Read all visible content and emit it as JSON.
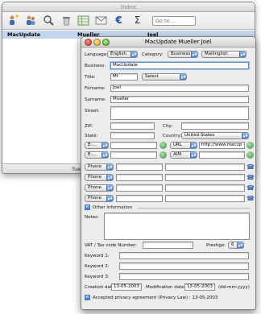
{
  "index_window": {
    "title": "Index",
    "toolbar_icons": [
      "new-contact-icon",
      "new-group-icon",
      "search-icon",
      "trash-icon",
      "spreadsheet-icon",
      "email-icon",
      "euro-icon",
      "sum-icon"
    ],
    "goto_placeholder": "Go to ...",
    "row": {
      "company": "MacUpdate",
      "name": "Mueller",
      "first": "Joel"
    },
    "status_text": "Tues"
  },
  "detail_window": {
    "title": "MacUpdate Mueller Joel",
    "language_label": "Language:",
    "language_value": "English",
    "category_label": "Category:",
    "category_value": "Business",
    "mailinglist_value": "Mailinglist:",
    "business_label": "Business:",
    "business_value": "MacUpdate",
    "title_label": "Title:",
    "title_value": "Mr.",
    "title_select": "Select",
    "forename_label": "Forname:",
    "forename_value": "Joel",
    "surname_label": "Surname:",
    "surname_value": "Mueller",
    "street_label": "Street:",
    "zip_label": "ZIP:",
    "city_label": "City:",
    "state_label": "State:",
    "country_label": "Country:",
    "country_value": "United States",
    "email_type_1": "E-...",
    "email_type_2": "E-...",
    "url_label": "URL",
    "url_value": "http://www.macup",
    "aim_label": "AIM",
    "phone_types": [
      "Phone",
      "Phone",
      "Phone",
      "Phone"
    ],
    "other_info_label": "Other information",
    "notes_label": "Notes:",
    "vat_label": "VAT / Tax code Number:",
    "prestige_label": "Prestige:",
    "prestige_value": "6",
    "keyword1_label": "Keyword 1:",
    "keyword2_label": "Keyword 2:",
    "keyword3_label": "Keyword 3:",
    "creation_label": "Creation date",
    "creation_value": "13-05-2003",
    "modification_label": "Modification date",
    "modification_value": "13-05-2003",
    "date_format": "(dd-mm-yyyy)",
    "privacy_label": "Accepted privacy agreement (Privacy Law) : 13-05-2003"
  }
}
